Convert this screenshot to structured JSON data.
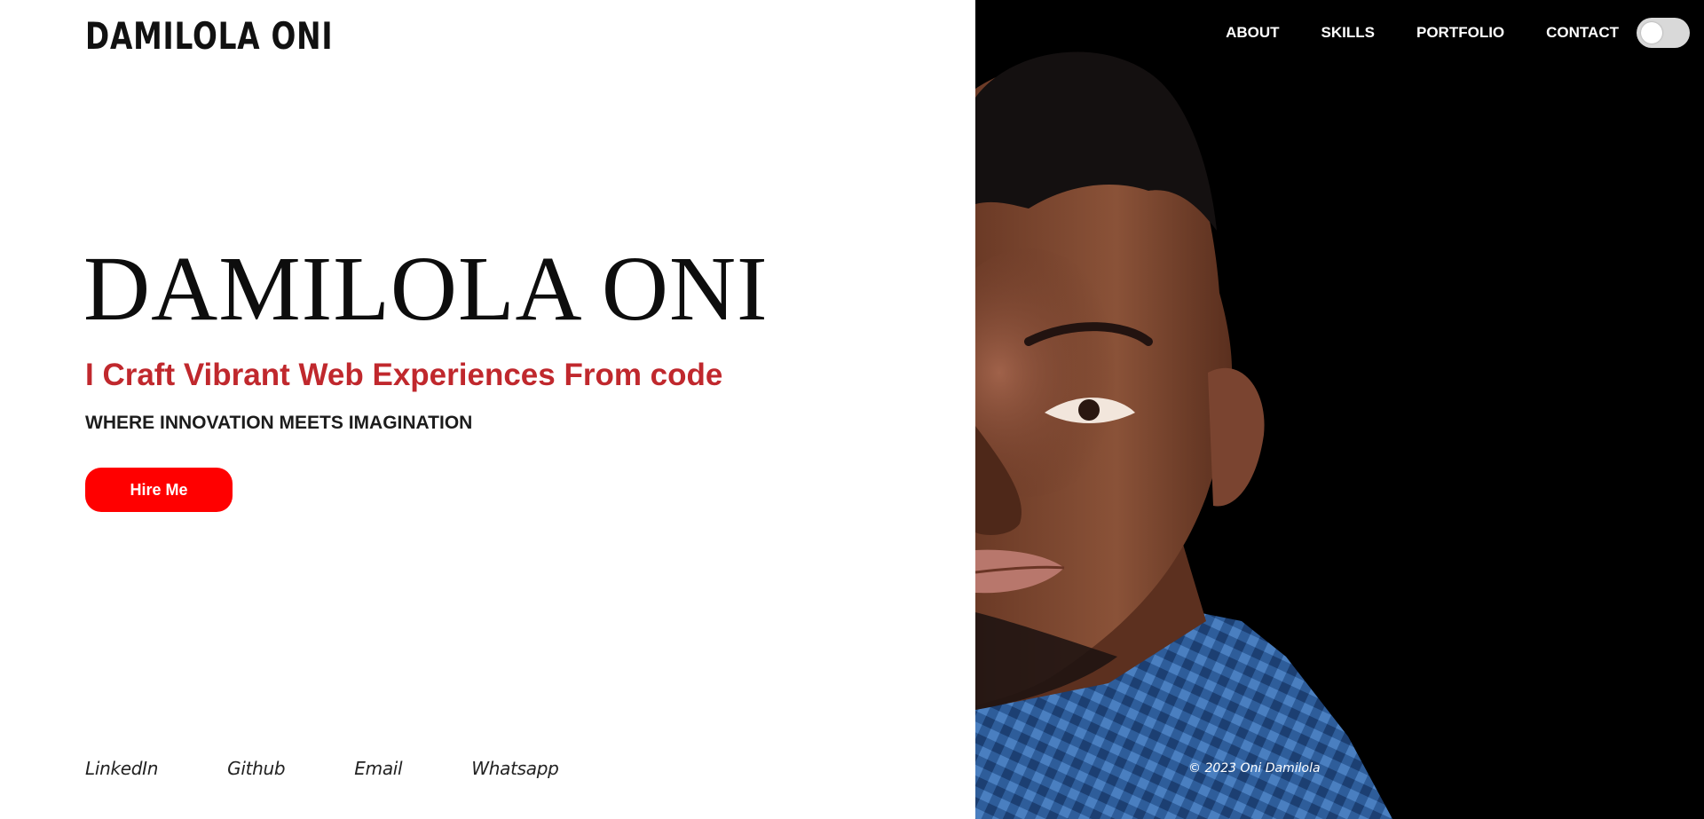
{
  "header": {
    "logo": "DAMILOLA ONI",
    "nav": [
      {
        "label": "ABOUT"
      },
      {
        "label": "SKILLS"
      },
      {
        "label": "PORTFOLIO"
      },
      {
        "label": "CONTACT"
      }
    ],
    "theme_toggle": {
      "state": "off"
    }
  },
  "hero": {
    "name": "DAMILOLA ONI",
    "tagline": "I Craft Vibrant Web Experiences From code",
    "subtitle": "WHERE INNOVATION MEETS IMAGINATION",
    "cta_label": "Hire Me"
  },
  "socials": [
    {
      "label": "LinkedIn"
    },
    {
      "label": "Github"
    },
    {
      "label": "Email"
    },
    {
      "label": "Whatsapp"
    }
  ],
  "footer": {
    "copyright": "© 2023 Oni Damilola"
  },
  "colors": {
    "accent_red": "#c0282d",
    "button_red": "#ff0000",
    "right_panel_bg": "#000000",
    "shirt_blue": "#2e5d9a"
  },
  "icons": {
    "theme_toggle": "toggle-switch-icon"
  }
}
